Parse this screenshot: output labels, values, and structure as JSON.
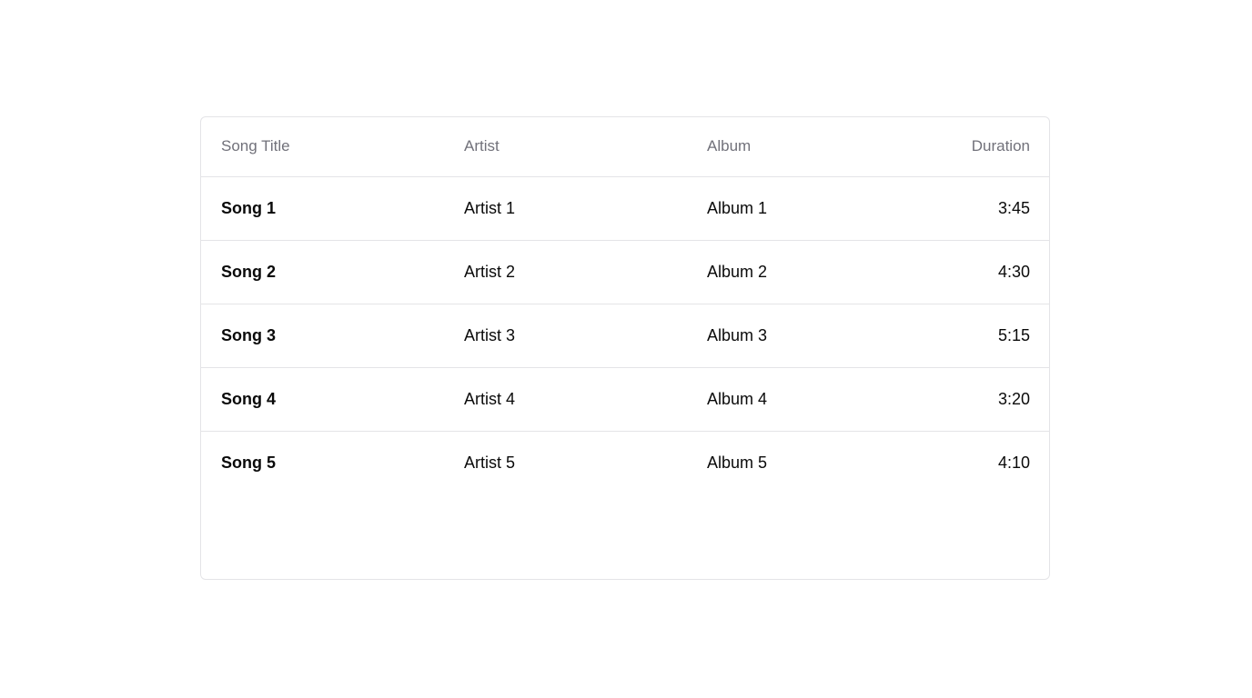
{
  "table": {
    "headers": {
      "title": "Song Title",
      "artist": "Artist",
      "album": "Album",
      "duration": "Duration"
    },
    "rows": [
      {
        "title": "Song 1",
        "artist": "Artist 1",
        "album": "Album 1",
        "duration": "3:45"
      },
      {
        "title": "Song 2",
        "artist": "Artist 2",
        "album": "Album 2",
        "duration": "4:30"
      },
      {
        "title": "Song 3",
        "artist": "Artist 3",
        "album": "Album 3",
        "duration": "5:15"
      },
      {
        "title": "Song 4",
        "artist": "Artist 4",
        "album": "Album 4",
        "duration": "3:20"
      },
      {
        "title": "Song 5",
        "artist": "Artist 5",
        "album": "Album 5",
        "duration": "4:10"
      }
    ]
  },
  "colors": {
    "border": "#e4e4e7",
    "header_text": "#71717a",
    "body_text": "#0a0a0a",
    "background": "#ffffff"
  }
}
